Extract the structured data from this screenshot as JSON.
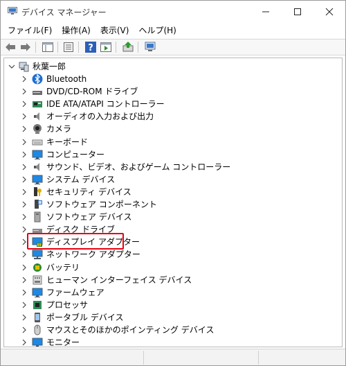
{
  "window": {
    "title": "デバイス マネージャー"
  },
  "menu": [
    {
      "label": "ファイル(F)"
    },
    {
      "label": "操作(A)"
    },
    {
      "label": "表示(V)"
    },
    {
      "label": "ヘルプ(H)"
    }
  ],
  "tree": {
    "root": "秋葉一郎",
    "items": [
      {
        "label": "Bluetooth",
        "icon": "bluetooth-icon"
      },
      {
        "label": "DVD/CD-ROM ドライブ",
        "icon": "optical-drive-icon"
      },
      {
        "label": "IDE ATA/ATAPI コントローラー",
        "icon": "ide-controller-icon"
      },
      {
        "label": "オーディオの入力および出力",
        "icon": "speaker-icon"
      },
      {
        "label": "カメラ",
        "icon": "camera-icon"
      },
      {
        "label": "キーボード",
        "icon": "keyboard-icon"
      },
      {
        "label": "コンピューター",
        "icon": "computer-icon"
      },
      {
        "label": "サウンド、ビデオ、およびゲーム コントローラー",
        "icon": "sound-icon"
      },
      {
        "label": "システム デバイス",
        "icon": "system-device-icon"
      },
      {
        "label": "セキュリティ デバイス",
        "icon": "security-key-icon"
      },
      {
        "label": "ソフトウェア コンポーネント",
        "icon": "software-component-icon"
      },
      {
        "label": "ソフトウェア デバイス",
        "icon": "software-device-icon"
      },
      {
        "label": "ディスク ドライブ",
        "icon": "disk-drive-icon"
      },
      {
        "label": "ディスプレイ アダプター",
        "icon": "display-adapter-icon"
      },
      {
        "label": "ネットワーク アダプター",
        "icon": "network-adapter-icon"
      },
      {
        "label": "バッテリ",
        "icon": "battery-icon"
      },
      {
        "label": "ヒューマン インターフェイス デバイス",
        "icon": "hid-icon"
      },
      {
        "label": "ファームウェア",
        "icon": "firmware-icon"
      },
      {
        "label": "プロセッサ",
        "icon": "processor-icon"
      },
      {
        "label": "ポータブル デバイス",
        "icon": "portable-device-icon"
      },
      {
        "label": "マウスとそのほかのポインティング デバイス",
        "icon": "mouse-icon"
      },
      {
        "label": "モニター",
        "icon": "monitor-icon"
      }
    ]
  },
  "highlight": {
    "item": "ディスプレイ アダプター",
    "color": "#e60012"
  },
  "colors": {
    "accent": "#2b6cc4",
    "highlight": "#e60012"
  }
}
